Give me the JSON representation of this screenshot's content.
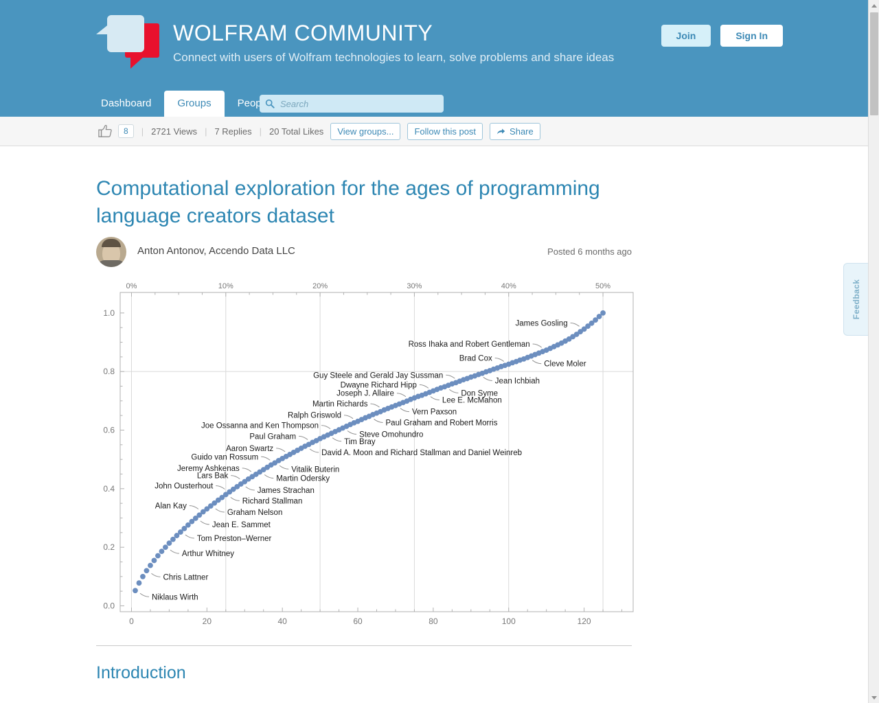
{
  "site": {
    "title": "WOLFRAM COMMUNITY",
    "tagline": "Connect with users of Wolfram technologies to learn, solve problems and share ideas",
    "join_label": "Join",
    "signin_label": "Sign In"
  },
  "nav": {
    "tabs": [
      {
        "label": "Dashboard",
        "active": false
      },
      {
        "label": "Groups",
        "active": true
      },
      {
        "label": "People",
        "active": false
      }
    ],
    "search": {
      "placeholder": "Search",
      "value": ""
    }
  },
  "actionbar": {
    "like_count": "8",
    "views": "2721 Views",
    "replies": "7 Replies",
    "total_likes": "20 Total Likes",
    "view_groups_label": "View groups...",
    "follow_label": "Follow this post",
    "share_label": "Share",
    "separator": "|"
  },
  "post": {
    "title": "Computational exploration for the ages of programming language creators dataset",
    "author": "Anton Antonov, Accendo Data LLC",
    "posted": "Posted 6 months ago",
    "section_heading": "Introduction"
  },
  "feedback": {
    "label": "Feedback"
  },
  "chart_data": {
    "type": "scatter",
    "title": "",
    "xlabel": "",
    "ylabel": "",
    "xlim": [
      -3,
      133
    ],
    "ylim": [
      -0.02,
      1.07
    ],
    "grid": true,
    "x_ticks": [
      0,
      20,
      40,
      60,
      80,
      100,
      120
    ],
    "y_ticks": [
      "0.0",
      "0.2",
      "0.4",
      "0.6",
      "0.8",
      "1.0"
    ],
    "top_axis_label": "percent",
    "top_ticks": [
      "0%",
      "10%",
      "20%",
      "30%",
      "40%",
      "50%"
    ],
    "top_tick_values": [
      0,
      10,
      20,
      30,
      40,
      50
    ],
    "x": [
      1,
      2,
      3,
      4,
      5,
      6,
      7,
      8,
      9,
      10,
      11,
      12,
      13,
      14,
      15,
      16,
      17,
      18,
      19,
      20,
      21,
      22,
      23,
      24,
      25,
      26,
      27,
      28,
      29,
      30,
      31,
      32,
      33,
      34,
      35,
      36,
      37,
      38,
      39,
      40,
      41,
      42,
      43,
      44,
      45,
      46,
      47,
      48,
      49,
      50,
      51,
      52,
      53,
      54,
      55,
      56,
      57,
      58,
      59,
      60,
      61,
      62,
      63,
      64,
      65,
      66,
      67,
      68,
      69,
      70,
      71,
      72,
      73,
      74,
      75,
      76,
      77,
      78,
      79,
      80,
      81,
      82,
      83,
      84,
      85,
      86,
      87,
      88,
      89,
      90,
      91,
      92,
      93,
      94,
      95,
      96,
      97,
      98,
      99,
      100,
      101,
      102,
      103,
      104,
      105,
      106,
      107,
      108,
      109,
      110,
      111,
      112,
      113,
      114,
      115,
      116,
      117,
      118,
      119,
      120,
      121,
      122,
      123,
      124,
      125
    ],
    "y": [
      0.052,
      0.078,
      0.1,
      0.12,
      0.138,
      0.155,
      0.171,
      0.186,
      0.2,
      0.214,
      0.227,
      0.24,
      0.252,
      0.264,
      0.276,
      0.288,
      0.299,
      0.31,
      0.321,
      0.331,
      0.341,
      0.351,
      0.361,
      0.37,
      0.38,
      0.389,
      0.398,
      0.407,
      0.416,
      0.424,
      0.433,
      0.441,
      0.449,
      0.457,
      0.465,
      0.473,
      0.481,
      0.488,
      0.496,
      0.503,
      0.51,
      0.517,
      0.524,
      0.531,
      0.538,
      0.545,
      0.551,
      0.558,
      0.564,
      0.571,
      0.577,
      0.583,
      0.589,
      0.595,
      0.601,
      0.607,
      0.613,
      0.619,
      0.625,
      0.63,
      0.636,
      0.642,
      0.647,
      0.653,
      0.658,
      0.663,
      0.669,
      0.674,
      0.679,
      0.684,
      0.689,
      0.694,
      0.699,
      0.705,
      0.71,
      0.715,
      0.719,
      0.724,
      0.729,
      0.734,
      0.739,
      0.744,
      0.748,
      0.753,
      0.758,
      0.762,
      0.767,
      0.772,
      0.776,
      0.781,
      0.785,
      0.79,
      0.794,
      0.799,
      0.803,
      0.808,
      0.812,
      0.817,
      0.821,
      0.825,
      0.83,
      0.834,
      0.839,
      0.843,
      0.848,
      0.853,
      0.858,
      0.863,
      0.868,
      0.873,
      0.879,
      0.885,
      0.891,
      0.897,
      0.904,
      0.911,
      0.919,
      0.927,
      0.936,
      0.945,
      0.955,
      0.965,
      0.976,
      0.988,
      1.0
    ],
    "annotations": [
      {
        "text": "Niklaus Wirth",
        "x": 1,
        "y": 0.052,
        "side": "right"
      },
      {
        "text": "Chris Lattner",
        "x": 4,
        "y": 0.12,
        "side": "right"
      },
      {
        "text": "Arthur Whitney",
        "x": 9,
        "y": 0.2,
        "side": "right"
      },
      {
        "text": "Tom Preston–Werner",
        "x": 13,
        "y": 0.252,
        "side": "right"
      },
      {
        "text": "Jean E. Sammet",
        "x": 17,
        "y": 0.299,
        "side": "right"
      },
      {
        "text": "Graham Nelson",
        "x": 21,
        "y": 0.341,
        "side": "right"
      },
      {
        "text": "Richard Stallman",
        "x": 25,
        "y": 0.38,
        "side": "right"
      },
      {
        "text": "Alan Kay",
        "x": 19,
        "y": 0.321,
        "side": "left"
      },
      {
        "text": "James Strachan",
        "x": 29,
        "y": 0.416,
        "side": "right"
      },
      {
        "text": "John Ousterhout",
        "x": 26,
        "y": 0.389,
        "side": "left"
      },
      {
        "text": "Lars Bak",
        "x": 30,
        "y": 0.424,
        "side": "left"
      },
      {
        "text": "Martin Odersky",
        "x": 34,
        "y": 0.457,
        "side": "right"
      },
      {
        "text": "Jeremy Ashkenas",
        "x": 33,
        "y": 0.449,
        "side": "left"
      },
      {
        "text": "Vitalik Buterin",
        "x": 38,
        "y": 0.488,
        "side": "right"
      },
      {
        "text": "Guido van Rossum",
        "x": 38,
        "y": 0.488,
        "side": "left"
      },
      {
        "text": "Aaron Swartz",
        "x": 42,
        "y": 0.517,
        "side": "left"
      },
      {
        "text": "David A. Moon and Richard Stallman and Daniel Weinreb",
        "x": 46,
        "y": 0.545,
        "side": "right"
      },
      {
        "text": "Paul Graham",
        "x": 48,
        "y": 0.558,
        "side": "left"
      },
      {
        "text": "Tim Bray",
        "x": 52,
        "y": 0.583,
        "side": "right"
      },
      {
        "text": "Joe Ossanna and Ken Thompson",
        "x": 54,
        "y": 0.595,
        "side": "left"
      },
      {
        "text": "Steve Omohundro",
        "x": 56,
        "y": 0.607,
        "side": "right"
      },
      {
        "text": "Ralph Griswold",
        "x": 60,
        "y": 0.63,
        "side": "left"
      },
      {
        "text": "Paul Graham and Robert Morris",
        "x": 63,
        "y": 0.647,
        "side": "right"
      },
      {
        "text": "Martin Richards",
        "x": 67,
        "y": 0.669,
        "side": "left"
      },
      {
        "text": "Vern Paxson",
        "x": 70,
        "y": 0.684,
        "side": "right"
      },
      {
        "text": "Joseph J. Allaire",
        "x": 74,
        "y": 0.705,
        "side": "left"
      },
      {
        "text": "Lee E. McMahon",
        "x": 78,
        "y": 0.724,
        "side": "right"
      },
      {
        "text": "Dwayne Richard Hipp",
        "x": 80,
        "y": 0.734,
        "side": "left"
      },
      {
        "text": "Don Syme",
        "x": 83,
        "y": 0.748,
        "side": "right"
      },
      {
        "text": "Guy Steele and Gerald Jay Sussman",
        "x": 87,
        "y": 0.767,
        "side": "left"
      },
      {
        "text": "Jean Ichbiah",
        "x": 92,
        "y": 0.79,
        "side": "right"
      },
      {
        "text": "Brad Cox",
        "x": 100,
        "y": 0.825,
        "side": "left"
      },
      {
        "text": "Cleve Moler",
        "x": 105,
        "y": 0.848,
        "side": "right"
      },
      {
        "text": "Ross Ihaka and Robert Gentleman",
        "x": 110,
        "y": 0.873,
        "side": "left"
      },
      {
        "text": "James Gosling",
        "x": 120,
        "y": 0.945,
        "side": "left"
      }
    ],
    "colors": {
      "point": "#6c8ebf",
      "axis": "#b0b0b0",
      "grid": "#d9d9d9",
      "label": "#1a1a1a",
      "leader": "#909090"
    }
  }
}
